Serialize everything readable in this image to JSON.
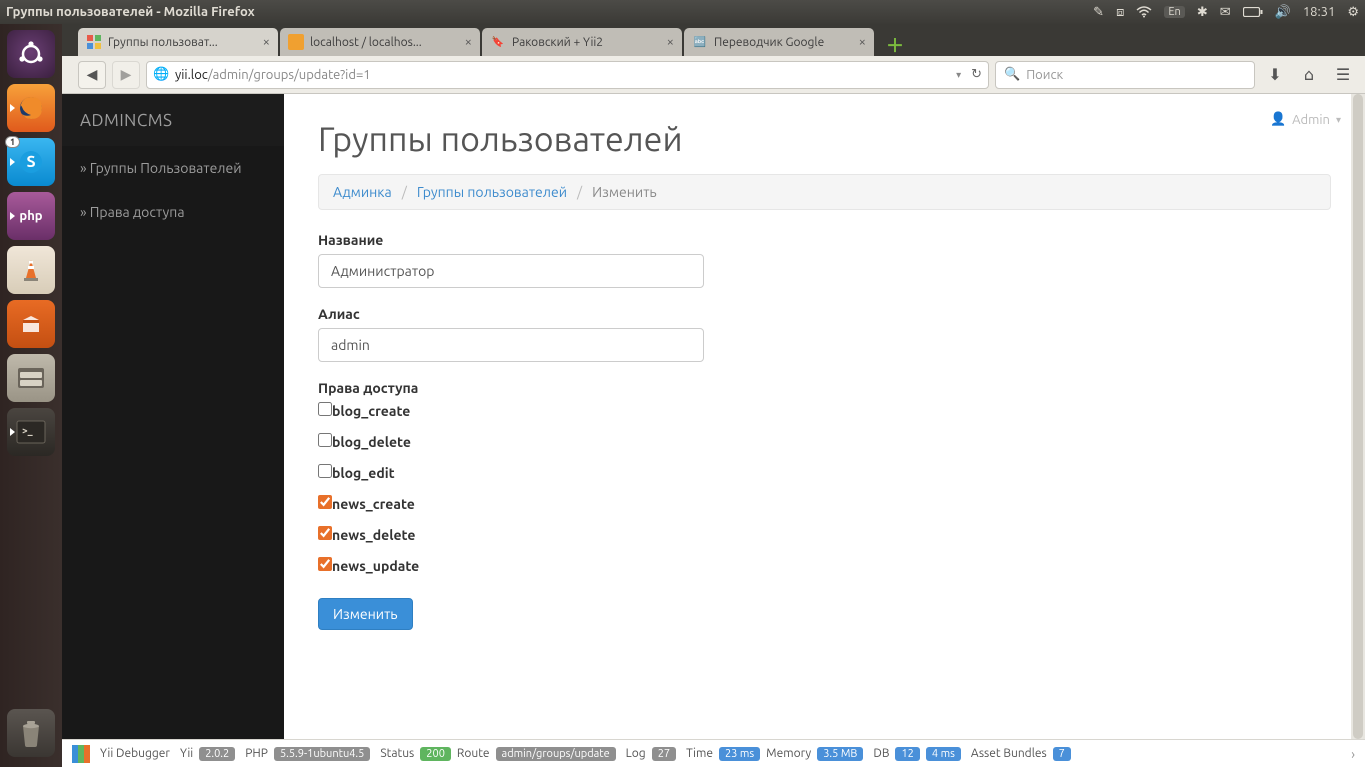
{
  "system": {
    "window_title": "Группы пользователей - Mozilla Firefox",
    "lang": "En",
    "time": "18:31"
  },
  "browser": {
    "tabs": [
      {
        "label": "Группы пользоват...",
        "active": true
      },
      {
        "label": "localhost / localhos...",
        "active": false
      },
      {
        "label": "Раковский + Yii2",
        "active": false
      },
      {
        "label": "Переводчик Google",
        "active": false
      }
    ],
    "url_host": "yii.loc",
    "url_path": "/admin/groups/update?id=1",
    "search_placeholder": "Поиск"
  },
  "app": {
    "brand": "ADMINCMS",
    "user_label": "Admin",
    "sidebar": [
      {
        "label": "» Группы Пользователей"
      },
      {
        "label": "» Права доступа"
      }
    ],
    "page_title": "Группы пользователей",
    "breadcrumb": {
      "admin": "Админка",
      "groups": "Группы пользователей",
      "active": "Изменить"
    },
    "form": {
      "name_label": "Название",
      "name_value": "Администратор",
      "alias_label": "Алиас",
      "alias_value": "admin",
      "permissions_label": "Права доступа",
      "permissions": [
        {
          "label": "blog_create",
          "checked": false
        },
        {
          "label": "blog_delete",
          "checked": false
        },
        {
          "label": "blog_edit",
          "checked": false
        },
        {
          "label": "news_create",
          "checked": true
        },
        {
          "label": "news_delete",
          "checked": true
        },
        {
          "label": "news_update",
          "checked": true
        }
      ],
      "submit_label": "Изменить"
    }
  },
  "debug": {
    "title": "Yii Debugger",
    "yii_label": "Yii",
    "yii_version": "2.0.2",
    "php_label": "PHP",
    "php_version": "5.5.9-1ubuntu4.5",
    "status_label": "Status",
    "status_code": "200",
    "route_label": "Route",
    "route_value": "admin/groups/update",
    "log_label": "Log",
    "log_value": "27",
    "time_label": "Time",
    "time_value": "23 ms",
    "memory_label": "Memory",
    "memory_value": "3.5 MB",
    "db_label": "DB",
    "db_count": "12",
    "db_time": "4 ms",
    "assets_label": "Asset Bundles",
    "assets_value": "7"
  }
}
